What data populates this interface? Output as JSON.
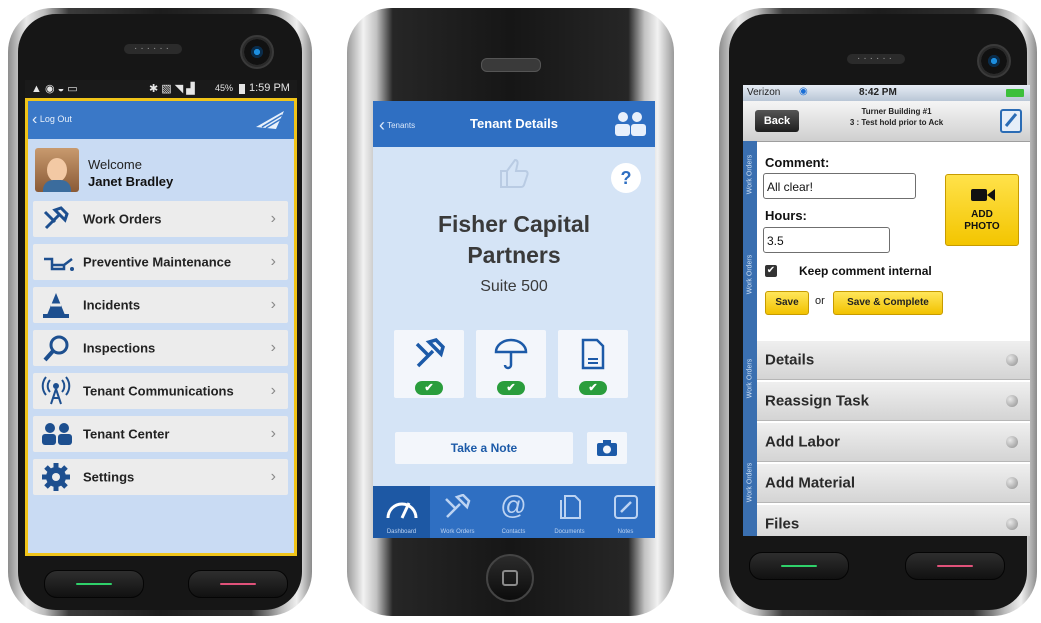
{
  "phone1": {
    "status": {
      "time": "1:59 PM",
      "battery": "45%"
    },
    "header": {
      "back_label": "Log Out"
    },
    "welcome": {
      "greeting": "Welcome",
      "name": "Janet Bradley"
    },
    "menu": [
      {
        "label": "Work Orders",
        "icon": "tools-icon"
      },
      {
        "label": "Preventive Maintenance",
        "icon": "oil-can-icon"
      },
      {
        "label": "Incidents",
        "icon": "traffic-cone-icon"
      },
      {
        "label": "Inspections",
        "icon": "magnifier-icon"
      },
      {
        "label": "Tenant Communications",
        "icon": "broadcast-icon"
      },
      {
        "label": "Tenant Center",
        "icon": "people-icon"
      },
      {
        "label": "Settings",
        "icon": "gear-icon"
      }
    ],
    "colors": {
      "accent": "#3a78c7",
      "frame": "#f0c419",
      "background": "#c9dbf3"
    }
  },
  "phone2": {
    "header": {
      "back_label": "Tenants",
      "title": "Tenant Details"
    },
    "help_label": "?",
    "tenant": {
      "name_line1": "Fisher Capital",
      "name_line2": "Partners",
      "suite": "Suite 500"
    },
    "tiles": [
      {
        "icon": "tools-icon",
        "status": "✔"
      },
      {
        "icon": "umbrella-icon",
        "status": "✔"
      },
      {
        "icon": "document-icon",
        "status": "✔"
      }
    ],
    "note_button": "Take a Note",
    "tabs": [
      {
        "label": "Dashboard",
        "icon": "gauge-icon"
      },
      {
        "label": "Work Orders",
        "icon": "tools-icon"
      },
      {
        "label": "Contacts",
        "icon": "at-icon"
      },
      {
        "label": "Documents",
        "icon": "documents-icon"
      },
      {
        "label": "Notes",
        "icon": "notes-icon"
      }
    ],
    "colors": {
      "accent": "#2f6fc2",
      "background": "#d5e4f6",
      "success": "#2a9d3c"
    }
  },
  "phone3": {
    "status": {
      "carrier": "Verizon",
      "time": "8:42 PM"
    },
    "header": {
      "back_label": "Back",
      "title_line1": "Turner Building #1",
      "title_line2": "3 : Test hold prior to Ack"
    },
    "side_label": "Work Orders",
    "comment": {
      "label": "Comment:",
      "value": "All clear!"
    },
    "hours": {
      "label": "Hours:",
      "value": "3.5"
    },
    "add_photo": "ADD\nPHOTO",
    "keep_internal": "Keep comment internal",
    "save_label": "Save",
    "or_label": "or",
    "save_complete_label": "Save & Complete",
    "sections": [
      "Details",
      "Reassign Task",
      "Add Labor",
      "Add Material",
      "Files"
    ],
    "colors": {
      "yellow": "#f6cf1e",
      "side": "#3a6fb0"
    }
  }
}
